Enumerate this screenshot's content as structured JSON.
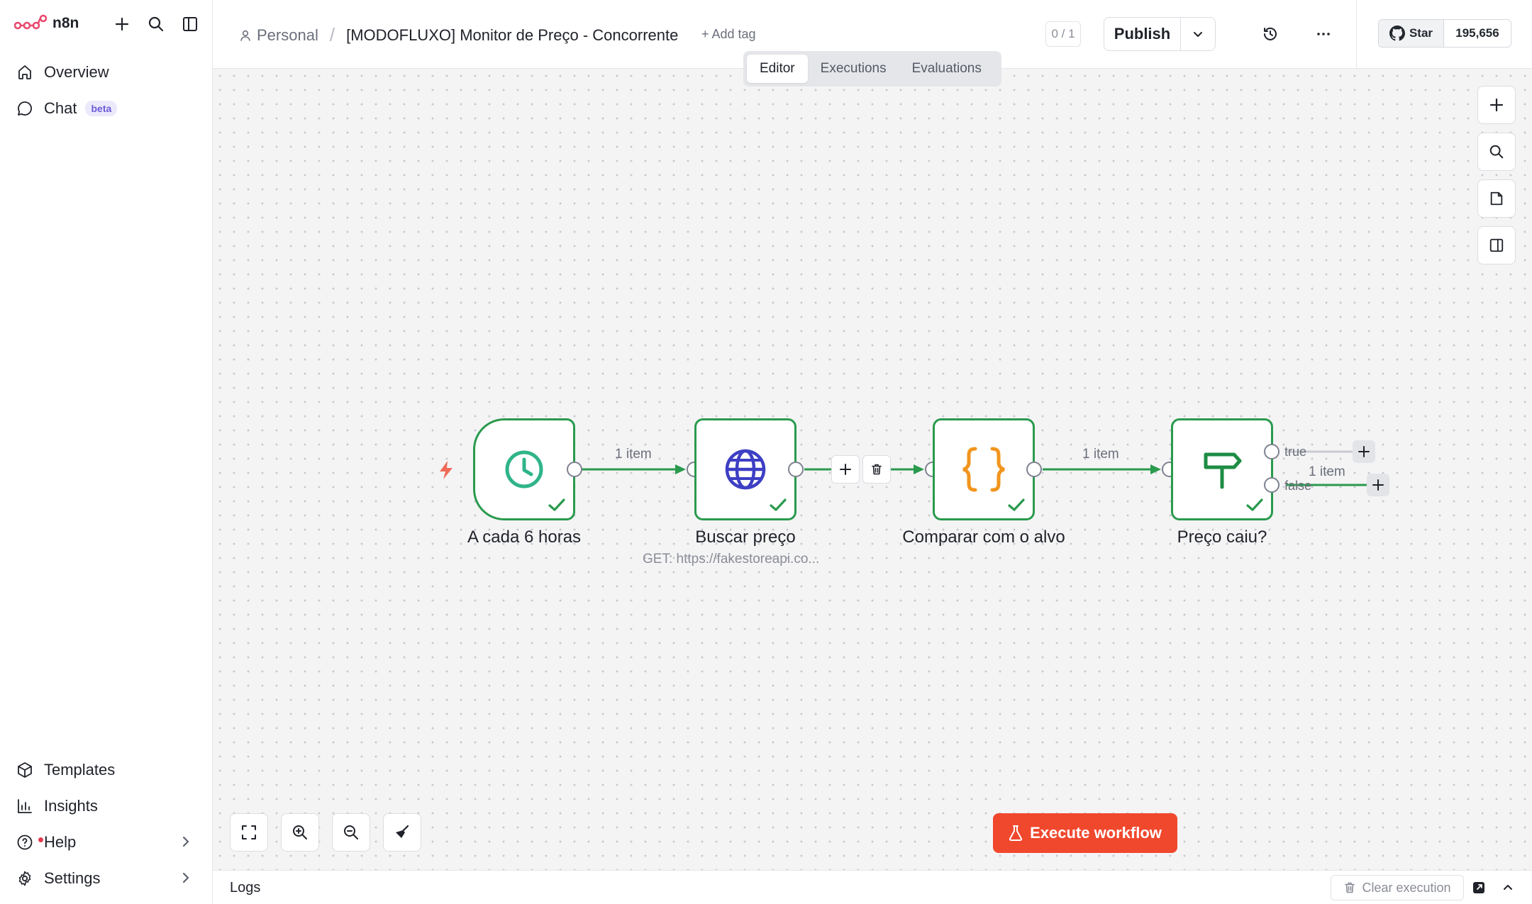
{
  "app": {
    "logo_text": "n8n"
  },
  "sidebar": {
    "items": [
      {
        "label": "Overview",
        "icon": "home-icon"
      },
      {
        "label": "Chat",
        "icon": "chat-icon",
        "badge": "beta"
      }
    ],
    "bottom_items": [
      {
        "label": "Templates",
        "icon": "box-icon"
      },
      {
        "label": "Insights",
        "icon": "bar-chart-icon"
      },
      {
        "label": "Help",
        "icon": "help-icon"
      },
      {
        "label": "Settings",
        "icon": "gear-icon"
      }
    ]
  },
  "header": {
    "project": "Personal",
    "separator": "/",
    "workflow_title": "[MODOFLUXO] Monitor de Preço - Concorrente",
    "add_tag": "+ Add tag",
    "counter": "0 / 1",
    "publish_label": "Publish",
    "github": {
      "star_label": "Star",
      "star_count": "195,656"
    }
  },
  "tabs": [
    {
      "label": "Editor",
      "active": true
    },
    {
      "label": "Executions",
      "active": false
    },
    {
      "label": "Evaluations",
      "active": false
    }
  ],
  "workflow": {
    "nodes": [
      {
        "label": "A cada 6 horas",
        "icon": "clock-icon"
      },
      {
        "label": "Buscar preço",
        "icon": "globe-icon",
        "subtitle": "GET: https://fakestoreapi.co..."
      },
      {
        "label": "Comparar com o alvo",
        "icon": "code-braces-icon"
      },
      {
        "label": "Preço caiu?",
        "icon": "signpost-icon"
      }
    ],
    "edges": [
      {
        "label": "1 item"
      },
      {
        "label": "1 item"
      },
      {
        "label": "1 item"
      }
    ],
    "if_outputs": {
      "true_label": "true",
      "false_label": "false"
    }
  },
  "actions": {
    "execute_workflow": "Execute workflow"
  },
  "logs": {
    "title": "Logs",
    "clear_execution": "Clear execution"
  },
  "colors": {
    "accent": "#f0482d",
    "node_success": "#2a9a4d",
    "trigger_icon": "#2fb489",
    "http_icon": "#3d3fc4",
    "code_icon": "#f1951e",
    "if_icon": "#1e8d44"
  }
}
